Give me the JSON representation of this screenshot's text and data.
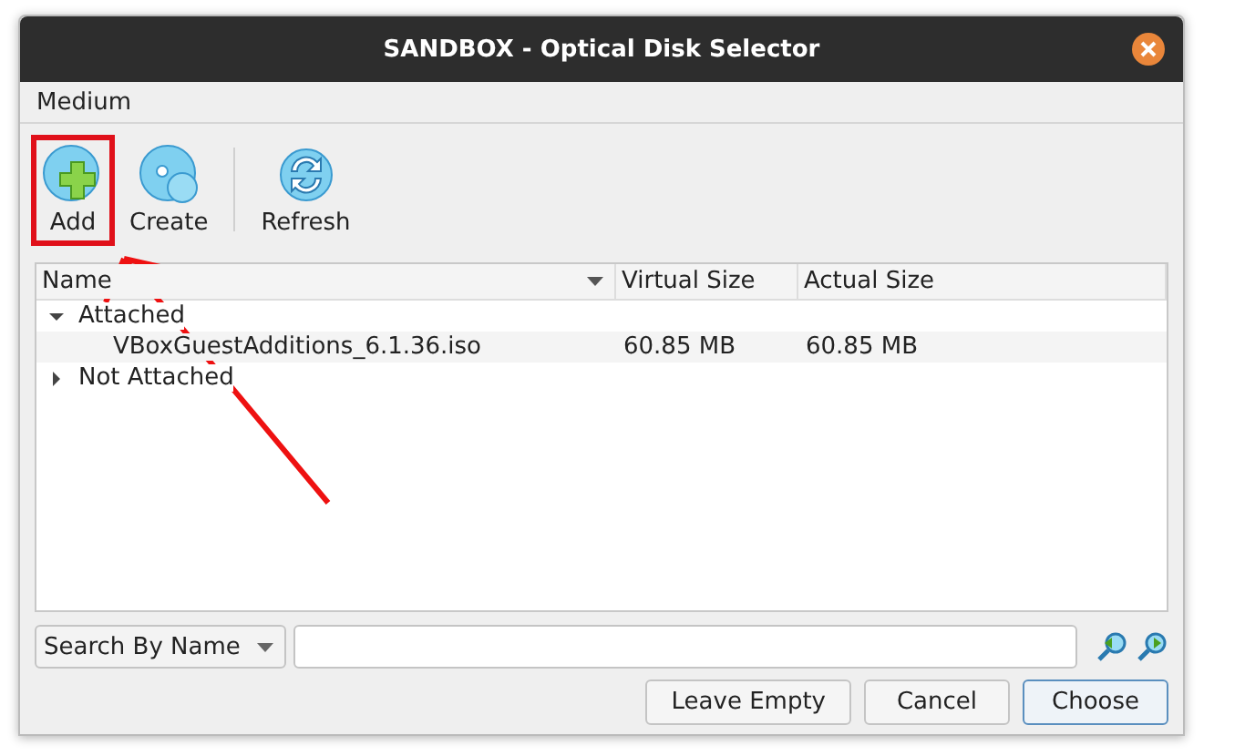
{
  "window": {
    "title": "SANDBOX - Optical Disk Selector"
  },
  "menu": [
    "Medium"
  ],
  "toolbar": [
    {
      "label": "Add",
      "kind": "add",
      "highlighted": true
    },
    {
      "label": "Create",
      "kind": "create",
      "highlighted": false
    },
    {
      "label": "Refresh",
      "kind": "refresh",
      "highlighted": false
    }
  ],
  "table": {
    "columns": [
      "Name",
      "Virtual Size",
      "Actual Size"
    ],
    "rows": [
      {
        "name": "Attached",
        "expanded": true,
        "children": [
          {
            "name": "VBoxGuestAdditions_6.1.36.iso",
            "virtual_size": "60.85 MB",
            "actual_size": "60.85 MB"
          }
        ]
      },
      {
        "name": "Not Attached",
        "expanded": false,
        "children": []
      }
    ]
  },
  "search": {
    "mode": "Search By Name"
  },
  "buttons": [
    {
      "label": "Leave Empty",
      "default": false
    },
    {
      "label": "Cancel",
      "default": false
    },
    {
      "label": "Choose",
      "default": true
    }
  ]
}
